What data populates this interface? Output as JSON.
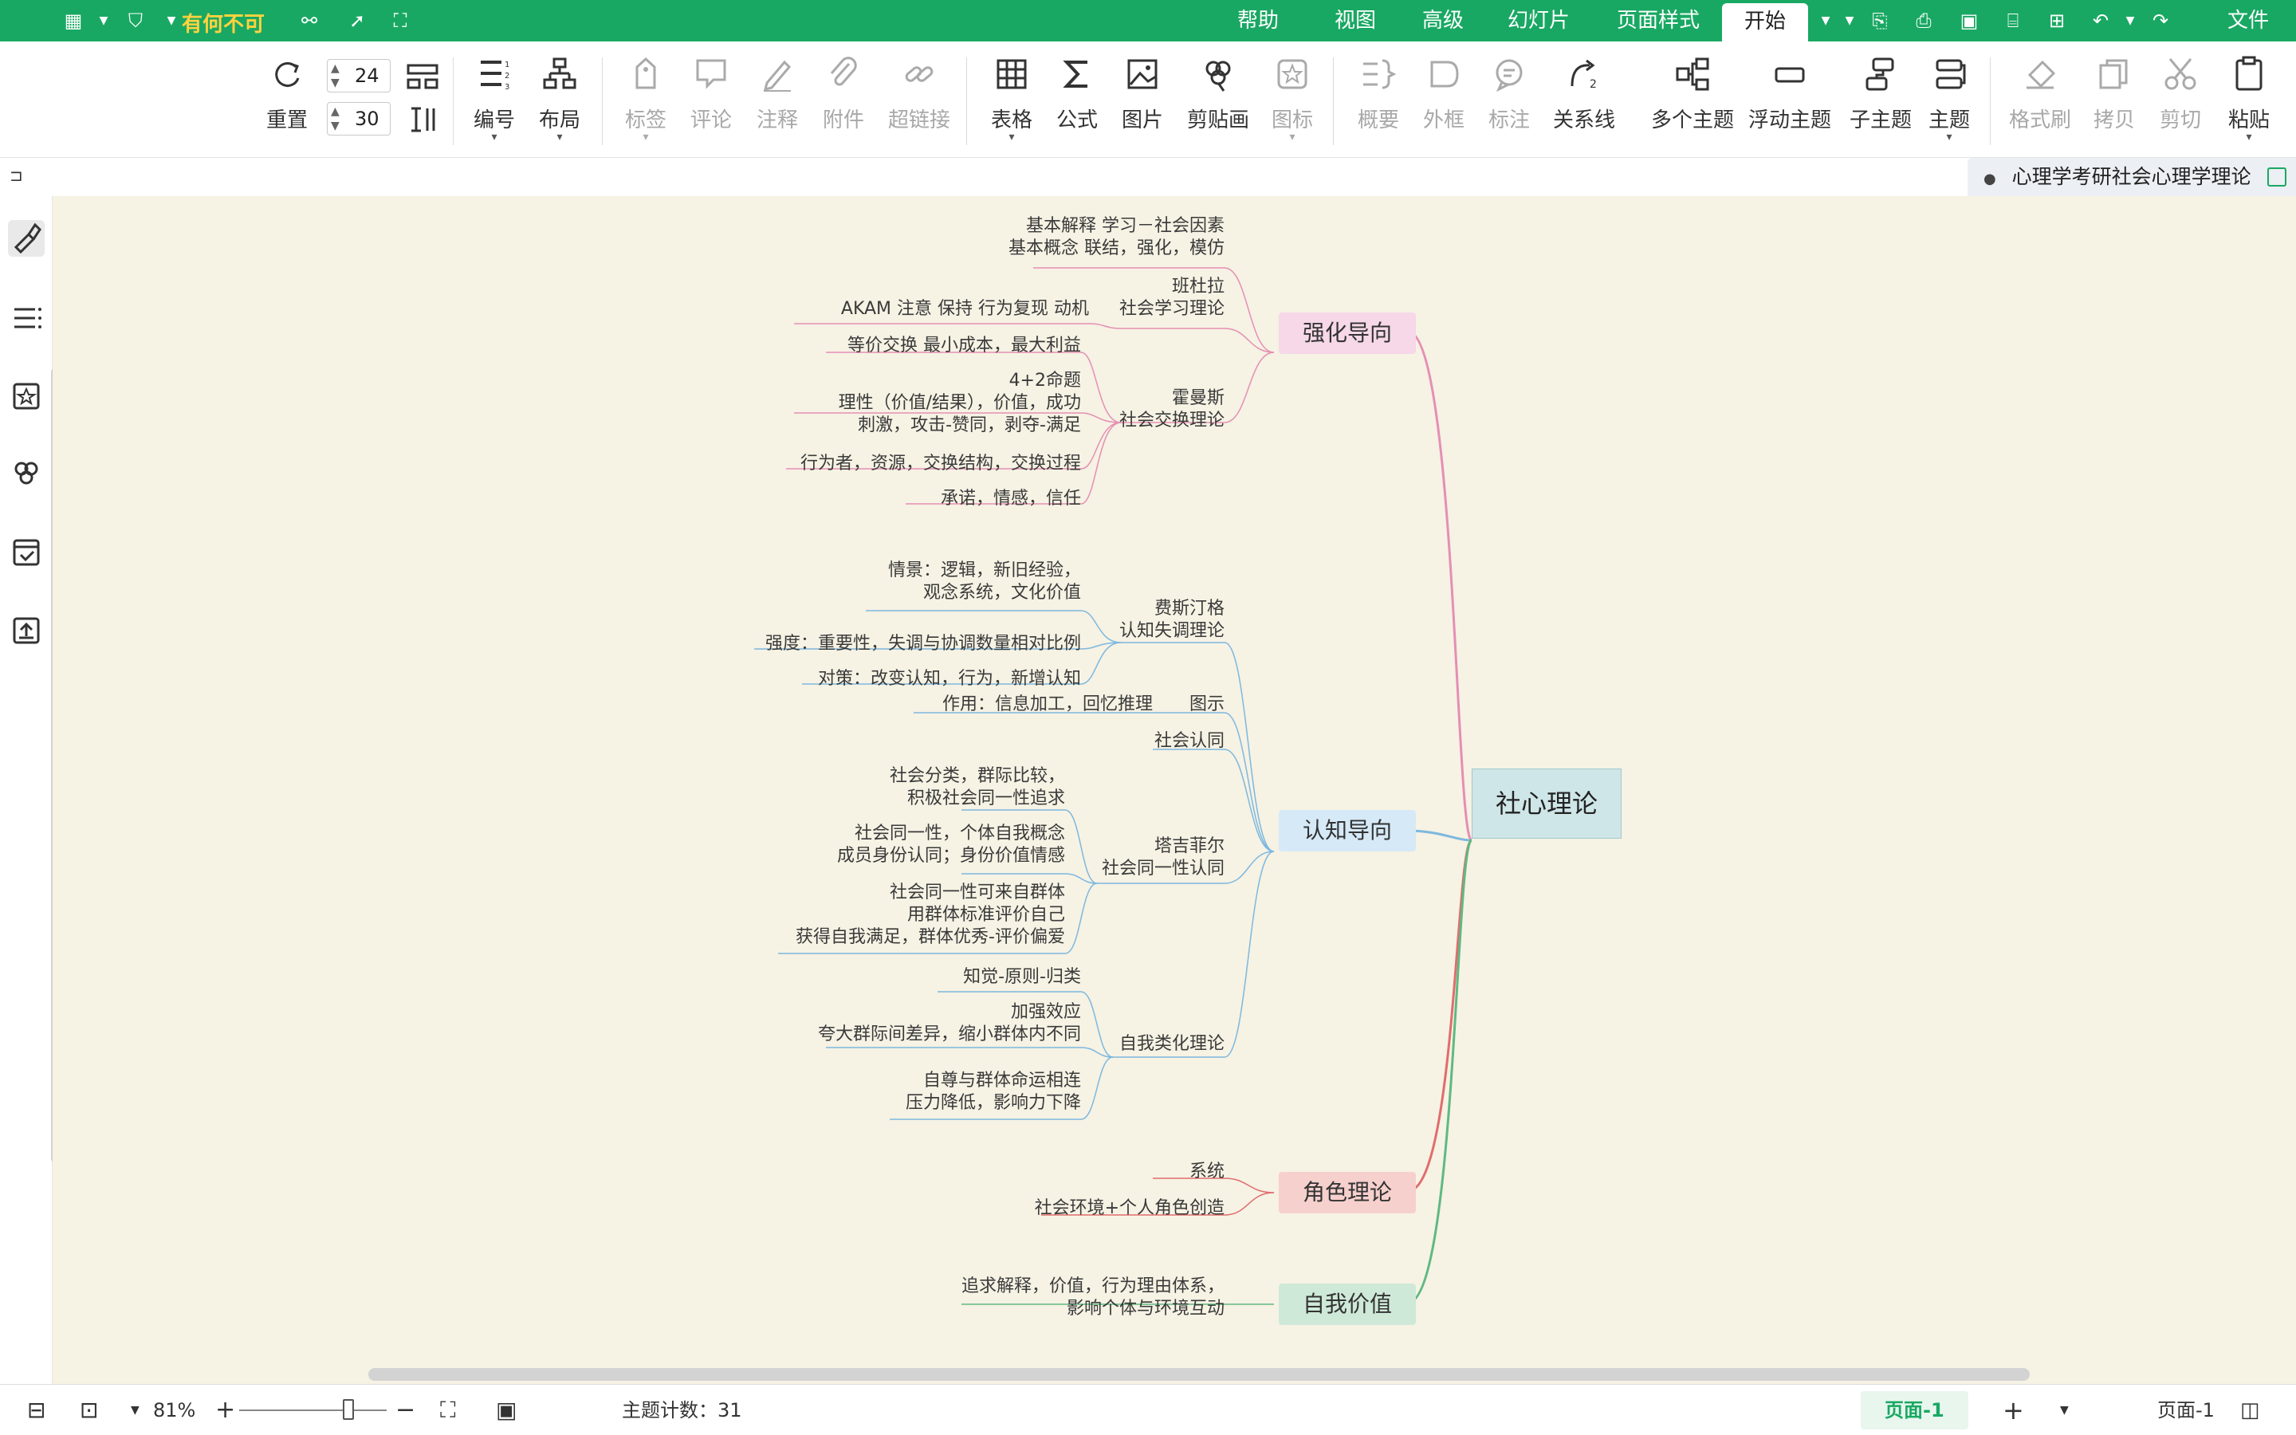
{
  "app": {
    "title": "有何不可"
  },
  "menu": {
    "file": "文件",
    "tabs": [
      "开始",
      "页面样式",
      "幻灯片",
      "高级",
      "视图",
      "帮助"
    ],
    "active": "开始"
  },
  "ribbon": {
    "paste": "粘贴",
    "cut": "剪切",
    "copy": "拷贝",
    "format_painter": "格式刷",
    "topic": "主题",
    "subtopic": "子主题",
    "floating_topic": "浮动主题",
    "multi_topic": "多个主题",
    "relationship": "关系线",
    "callout": "标注",
    "boundary": "外框",
    "summary": "概要",
    "icon": "图标",
    "clipart": "剪贴画",
    "picture": "图片",
    "formula": "公式",
    "table": "表格",
    "hyperlink": "超链接",
    "attachment": "附件",
    "note": "注释",
    "comment": "评论",
    "tag": "标签",
    "layout": "布局",
    "numbering": "编号",
    "spacing_h": "24",
    "spacing_v": "30",
    "reset": "重置"
  },
  "doc_tab": {
    "name": "心理学考研社会心理学理论"
  },
  "mindmap": {
    "root": "社心理论",
    "branches": [
      {
        "id": "b1",
        "title": "强化导向",
        "color": "#e58fb3",
        "fill": "#f6d8e8"
      },
      {
        "id": "b2",
        "title": "认知导向",
        "color": "#7db8df",
        "fill": "#d6e9f7"
      },
      {
        "id": "b3",
        "title": "角色理论",
        "color": "#e06d6d",
        "fill": "#f6d0cd"
      },
      {
        "id": "b4",
        "title": "自我价值",
        "color": "#5fb982",
        "fill": "#cfe9d8"
      }
    ],
    "nodes": [
      {
        "id": "n1",
        "lines": [
          "基本解释    学习－社会因素",
          "基本概念    联结，强化，模仿"
        ]
      },
      {
        "id": "n2",
        "lines": [
          "班杜拉",
          "社会学习理论"
        ]
      },
      {
        "id": "n3",
        "lines": [
          "AKAM  注意  保持  行为复现  动机"
        ]
      },
      {
        "id": "n4",
        "lines": [
          "等价交换 最小成本，最大利益"
        ]
      },
      {
        "id": "n5",
        "lines": [
          "霍曼斯",
          "社会交换理论"
        ]
      },
      {
        "id": "n6",
        "lines": [
          "4+2命题",
          "理性（价值/结果），价值，成功",
          "刺激，攻击-赞同，剥夺-满足"
        ]
      },
      {
        "id": "n7",
        "lines": [
          "行为者，资源，交换结构，交换过程"
        ]
      },
      {
        "id": "n8",
        "lines": [
          "承诺，情感，信任"
        ]
      },
      {
        "id": "n9",
        "lines": [
          "情景：逻辑，新旧经验，",
          "观念系统，文化价值"
        ]
      },
      {
        "id": "n10",
        "lines": [
          "费斯汀格",
          "认知失调理论"
        ]
      },
      {
        "id": "n11",
        "lines": [
          "强度：重要性，失调与协调数量相对比例"
        ]
      },
      {
        "id": "n12",
        "lines": [
          "对策：改变认知，行为，新增认知"
        ]
      },
      {
        "id": "n13",
        "lines": [
          "图示"
        ]
      },
      {
        "id": "n14",
        "lines": [
          "作用：信息加工，回忆推理"
        ]
      },
      {
        "id": "n15",
        "lines": [
          "社会认同"
        ]
      },
      {
        "id": "n16",
        "lines": [
          "社会分类，群际比较，",
          "积极社会同一性追求"
        ]
      },
      {
        "id": "n17",
        "lines": [
          "塔吉菲尔",
          "社会同一性认同"
        ]
      },
      {
        "id": "n18",
        "lines": [
          "社会同一性，个体自我概念",
          "成员身份认同；身份价值情感"
        ]
      },
      {
        "id": "n19",
        "lines": [
          "社会同一性可来自群体",
          "用群体标准评价自己",
          "获得自我满足，群体优秀-评价偏爱"
        ]
      },
      {
        "id": "n20",
        "lines": [
          "知觉-原则-归类"
        ]
      },
      {
        "id": "n21",
        "lines": [
          "自我类化理论"
        ]
      },
      {
        "id": "n22",
        "lines": [
          "加强效应",
          "夸大群际间差异，缩小群体内不同"
        ]
      },
      {
        "id": "n23",
        "lines": [
          "自尊与群体命运相连",
          "压力降低，影响力下降"
        ]
      },
      {
        "id": "n24",
        "lines": [
          "系统"
        ]
      },
      {
        "id": "n25",
        "lines": [
          "社会环境+个人角色创造"
        ]
      },
      {
        "id": "n26",
        "lines": [
          "追求解释，价值，行为理由体系，",
          "影响个体与环境互动"
        ]
      }
    ]
  },
  "status": {
    "topic_count": "主题计数：31",
    "zoom": "81%",
    "page_tab": "页面-1",
    "page_select": "页面-1"
  },
  "colors": {
    "brand": "#19a863",
    "canvas": "#f6f2e4",
    "title_accent": "#ffd23f"
  }
}
